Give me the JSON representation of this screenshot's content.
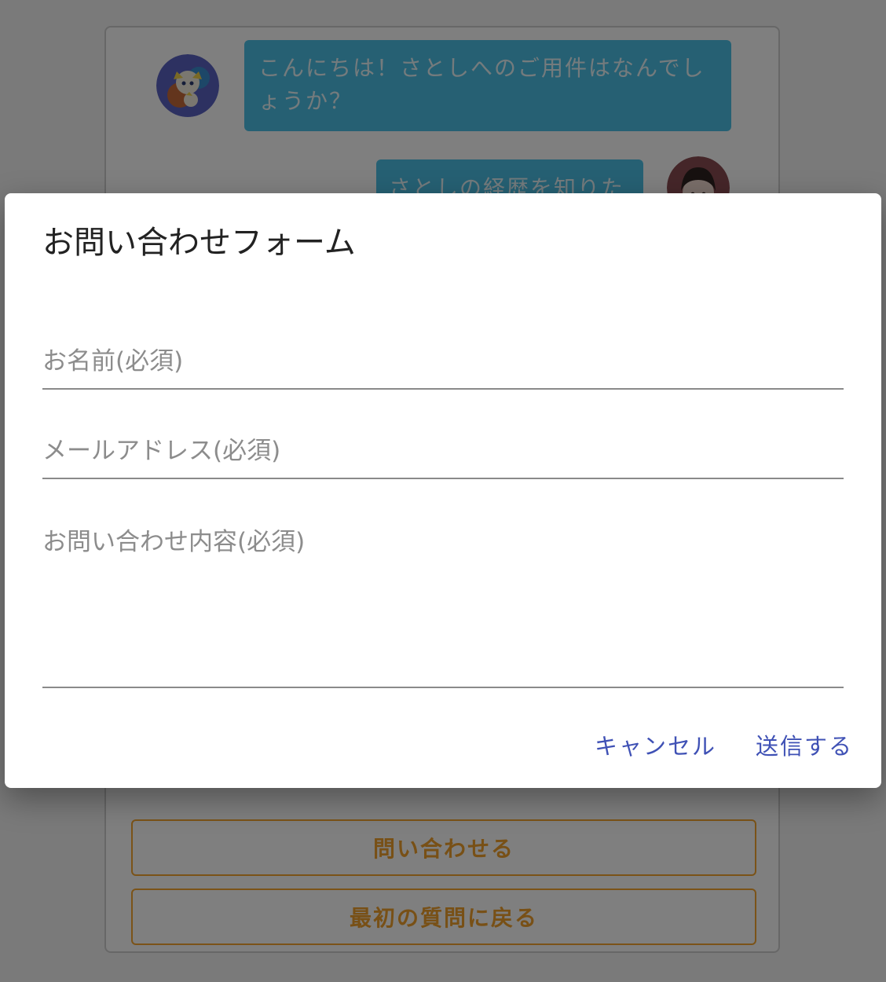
{
  "chat": {
    "bot_message": "こんにちは！さとしへのご用件はなんでしょうか？",
    "user_message": "さとしの経歴を知りたい",
    "bot_avatar_icon": "character-avatar-icon",
    "user_avatar_icon": "user-avatar-icon",
    "buttons": {
      "inquire": "問い合わせる",
      "back_to_first": "最初の質問に戻る"
    }
  },
  "dialog": {
    "title": "お問い合わせフォーム",
    "fields": {
      "name_label": "お名前(必須)",
      "email_label": "メールアドレス(必須)",
      "message_label": "お問い合わせ内容(必須)"
    },
    "actions": {
      "cancel": "キャンセル",
      "submit": "送信する"
    }
  },
  "colors": {
    "bubble": "#4cc1e6",
    "choice_border": "#f6a731",
    "action_text": "#3f51b5"
  }
}
